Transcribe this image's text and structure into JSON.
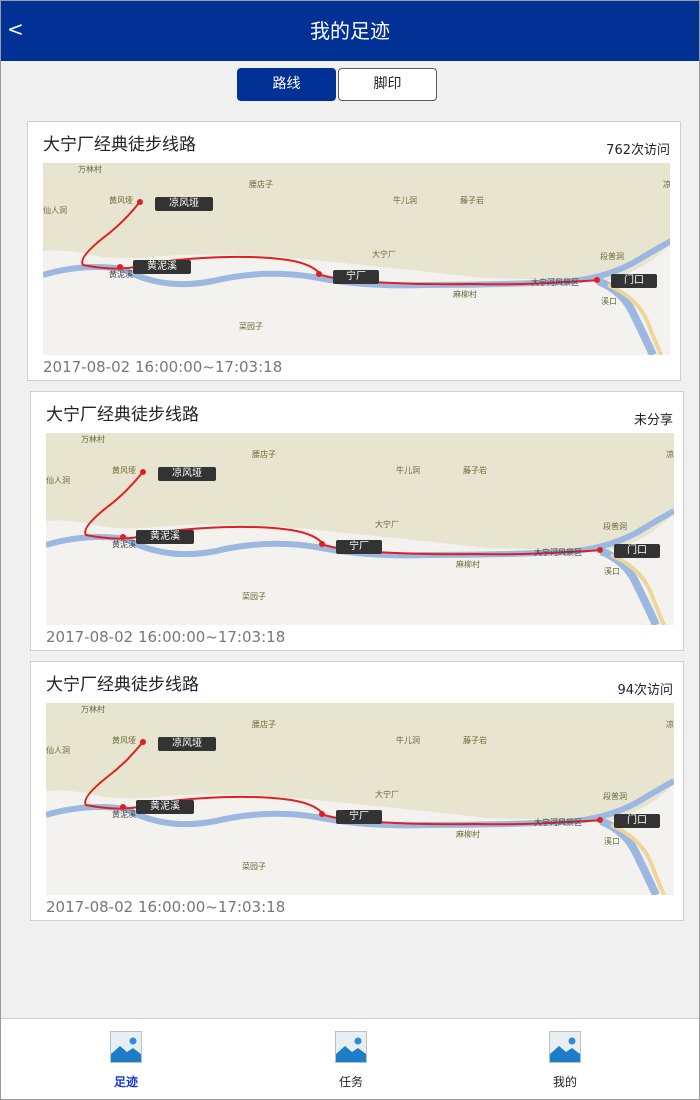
{
  "header": {
    "back_label": "<",
    "title": "我的足迹"
  },
  "segment": {
    "routes_label": "路线",
    "footprints_label": "脚印"
  },
  "cards": [
    {
      "title": "大宁厂经典徒步线路",
      "status": "762次访问",
      "time": "2017-08-02 16:00:00~17:03:18",
      "map": {
        "markers": [
          "凉风垭",
          "黄泥溪",
          "宁厂",
          "门口"
        ],
        "places": [
          "万林村",
          "仙人洞",
          "黄风垭",
          "腰店子",
          "牛儿洞",
          "藤子岩",
          "大宁厂",
          "段普洞",
          "大宁河风景区",
          "麻柳村",
          "溪口",
          "菜园子",
          "凉",
          "黄泥溪"
        ]
      }
    },
    {
      "title": "大宁厂经典徒步线路",
      "status": "未分享",
      "time": "2017-08-02 16:00:00~17:03:18",
      "map": {
        "markers": [
          "凉风垭",
          "黄泥溪",
          "宁厂",
          "门口"
        ],
        "places": [
          "万林村",
          "仙人洞",
          "黄风垭",
          "腰店子",
          "牛儿洞",
          "藤子岩",
          "大宁厂",
          "段普洞",
          "大宁河风景区",
          "麻柳村",
          "溪口",
          "菜园子",
          "凉",
          "黄泥溪"
        ]
      }
    },
    {
      "title": "大宁厂经典徒步线路",
      "status": "94次访问",
      "time": "2017-08-02 16:00:00~17:03:18",
      "map": {
        "markers": [
          "凉风垭",
          "黄泥溪",
          "宁厂",
          "门口"
        ],
        "places": [
          "万林村",
          "仙人洞",
          "黄风垭",
          "腰店子",
          "牛儿洞",
          "藤子岩",
          "大宁厂",
          "段普洞",
          "大宁河风景区",
          "麻柳村",
          "溪口",
          "菜园子",
          "凉",
          "黄泥溪"
        ]
      }
    }
  ],
  "tabbar": {
    "items": [
      {
        "label": "足迹",
        "icon": "image-placeholder-icon"
      },
      {
        "label": "任务",
        "icon": "image-placeholder-icon"
      },
      {
        "label": "我的",
        "icon": "image-placeholder-icon"
      }
    ]
  },
  "colors": {
    "brand": "#023196",
    "route": "#e02020",
    "river": "#9db8e0",
    "active_tab": "#1a3bd1"
  }
}
